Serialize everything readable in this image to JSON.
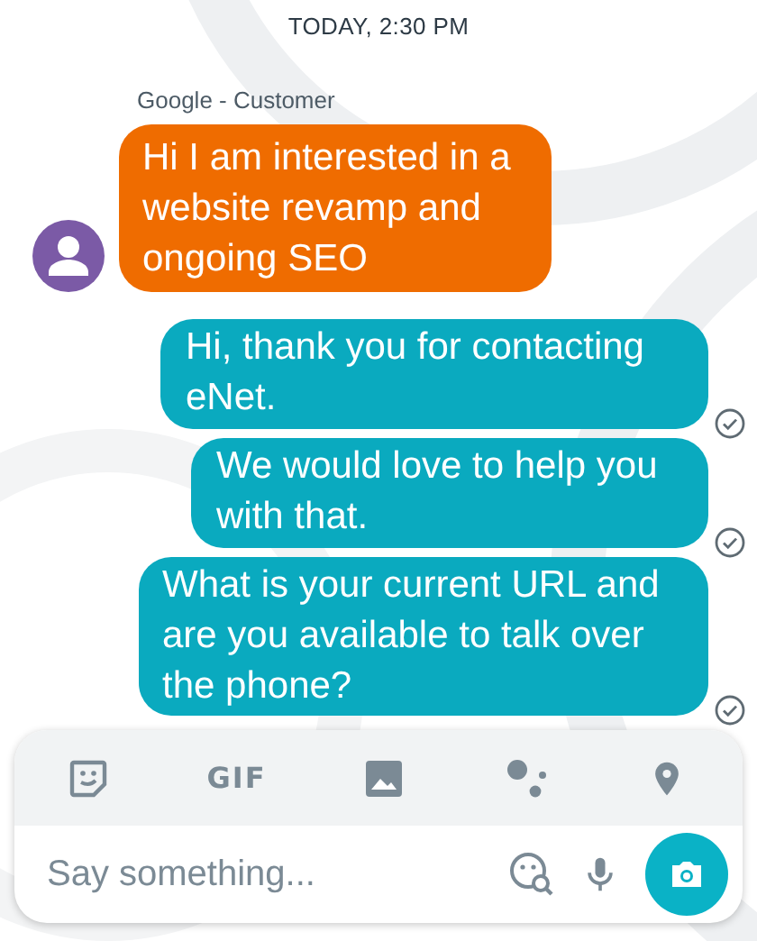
{
  "timestamp": "TODAY, 2:30 PM",
  "messages": [
    {
      "kind": "incoming",
      "sender": "Google - Customer",
      "text": "Hi I am interested in a website revamp and ongoing SEO"
    },
    {
      "kind": "outgoing",
      "text": "Hi, thank you for contacting eNet.",
      "delivered": true
    },
    {
      "kind": "outgoing",
      "text": "We would love to help you with that.",
      "delivered": true
    },
    {
      "kind": "outgoing",
      "text": "What is your current URL and are you available to talk over the phone?",
      "delivered": true
    }
  ],
  "toolbar": [
    {
      "kind": "sticker"
    },
    {
      "kind": "gif",
      "label": "GIF"
    },
    {
      "kind": "image"
    },
    {
      "kind": "assistant"
    },
    {
      "kind": "location"
    }
  ],
  "composer": {
    "placeholder": "Say something..."
  }
}
